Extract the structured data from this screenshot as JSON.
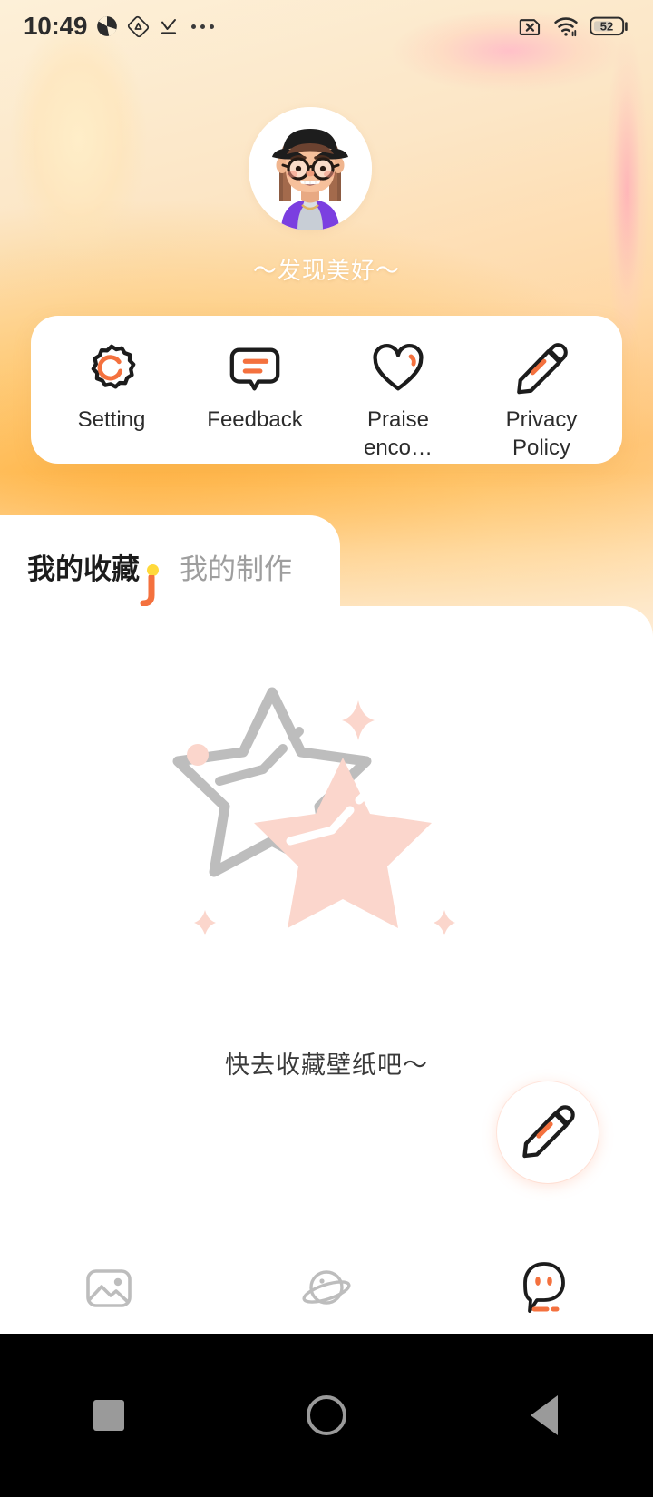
{
  "statusbar": {
    "time": "10:49",
    "battery_level": "52",
    "icons": {
      "app1": "shutter-icon",
      "app2": "triangle-drop-icon",
      "download": "download-check-icon",
      "more": "more-dots-icon",
      "sim": "sim-disabled-icon",
      "wifi": "wifi-icon",
      "battery": "battery-icon"
    }
  },
  "profile": {
    "avatar_name": "user-avatar",
    "nickname": "〜发现美好〜"
  },
  "menu": {
    "items": [
      {
        "label": "Setting",
        "icon": "gear-icon"
      },
      {
        "label": "Feedback",
        "icon": "chat-bubble-icon"
      },
      {
        "label": "Praise enco…",
        "icon": "heart-icon"
      },
      {
        "label": "Privacy Policy",
        "icon": "pencil-icon"
      }
    ]
  },
  "tabs": [
    {
      "label": "我的收藏",
      "active": true
    },
    {
      "label": "我的制作",
      "active": false
    }
  ],
  "empty_state": {
    "illustration": "star-empty-illustration",
    "message": "快去收藏壁纸吧〜"
  },
  "fab": {
    "icon": "pencil-icon",
    "label": "edit"
  },
  "bottom_nav": [
    {
      "icon": "image-icon",
      "active": false
    },
    {
      "icon": "planet-icon",
      "active": false
    },
    {
      "icon": "face-profile-icon",
      "active": true
    }
  ],
  "system_nav": [
    {
      "icon": "recents-square-icon"
    },
    {
      "icon": "home-circle-icon"
    },
    {
      "icon": "back-triangle-icon"
    }
  ],
  "colors": {
    "accent_orange": "#f4713e",
    "accent_yellow": "#ffd93b",
    "pink_star": "#fbd6cc",
    "grey_star": "#bdbdbd",
    "text_dark": "#1c1c1c",
    "text_muted": "#9e9e9e"
  }
}
